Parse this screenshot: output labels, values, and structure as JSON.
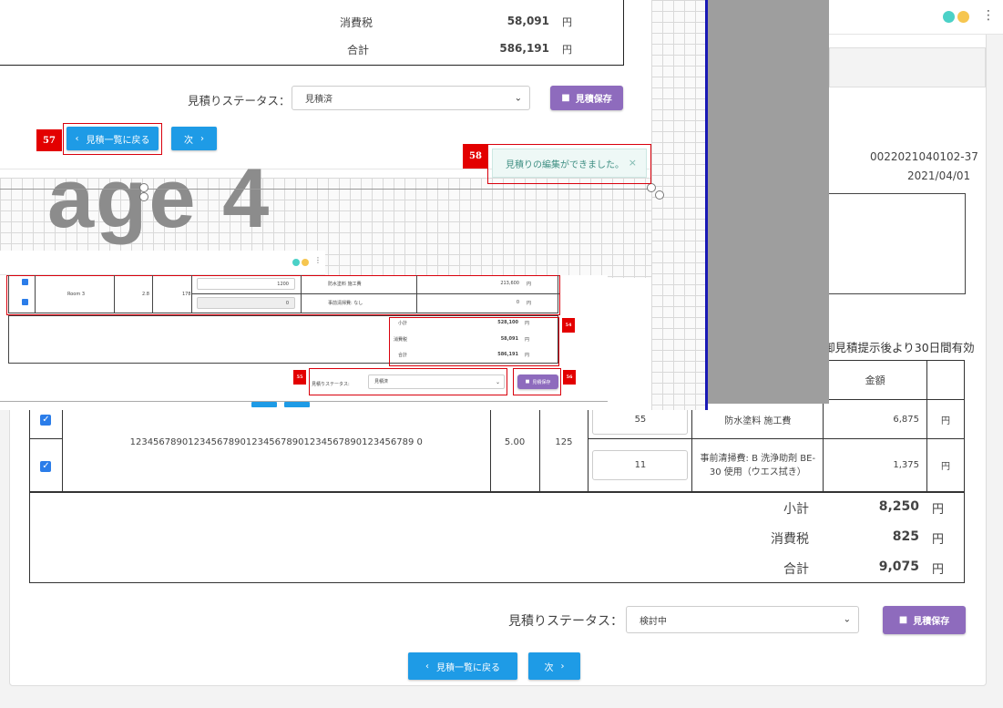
{
  "colors": {
    "accent_blue": "#1e9be6",
    "purple": "#8e6bbd",
    "annotation_red": "#e30000",
    "frame_blue": "#1a1ab5",
    "dot_teal": "#4bd1c7",
    "dot_yellow": "#f6c650"
  },
  "icons": {
    "save": "save-icon",
    "back": "chevron-left-icon",
    "next": "chevron-right-icon",
    "kebab": "kebab-menu-icon",
    "close": "close-icon"
  },
  "main": {
    "doc_number": "0022021040102-37",
    "doc_date": "2021/04/01",
    "validity_fragment": "御見積提示後より30日間有効",
    "table": {
      "amount_header": "金額",
      "rows": [
        {
          "qty": "55",
          "desc": "防水塗料 施工費",
          "amount": "6,875",
          "unit": "円"
        },
        {
          "qty": "11",
          "desc": "事前清掃費: B 洗浄助剤 BE-30 使用（ウエス拭き）",
          "amount": "1,375",
          "unit": "円"
        }
      ],
      "room_text": "1234567890123456789012345678901234567890123456789 0",
      "area": "5.00",
      "height": "125"
    },
    "totals": [
      {
        "label": "小計",
        "value": "8,250",
        "unit": "円"
      },
      {
        "label": "消費税",
        "value": "825",
        "unit": "円"
      },
      {
        "label": "合計",
        "value": "9,075",
        "unit": "円"
      }
    ],
    "status_label": "見積りステータス：",
    "status_value": "検討中",
    "save_label": "見積保存",
    "back_label": "見積一覧に戻る",
    "next_label": "次"
  },
  "overlay": {
    "totals": [
      {
        "label": "消費税",
        "value": "58,091",
        "unit": "円"
      },
      {
        "label": "合計",
        "value": "586,191",
        "unit": "円"
      }
    ],
    "status_label": "見積りステータス：",
    "status_value": "見積済",
    "save_label": "見積保存",
    "back_label": "見積一覧に戻る",
    "next_label": "次",
    "tag_57": "57",
    "tag_58": "58",
    "toast": "見積りの編集ができました。",
    "big_text": "age 4",
    "mini": {
      "room": "Room 3",
      "area": "2.8",
      "height": "178",
      "row1": {
        "qty": "1200",
        "desc": "防水塗料 施工費",
        "amount": "213,600",
        "unit": "円"
      },
      "row2": {
        "qty": "0",
        "desc": "事前清掃費: なし",
        "amount": "0",
        "unit": "円"
      },
      "totals": [
        {
          "label": "小計",
          "value": "528,100",
          "unit": "円"
        },
        {
          "label": "消費税",
          "value": "58,091",
          "unit": "円"
        },
        {
          "label": "合計",
          "value": "586,191",
          "unit": "円"
        }
      ],
      "status_label": "見積りステータス:",
      "status_value": "見積済",
      "save_label": "見積保存",
      "tag_54": "54",
      "tag_55": "55",
      "tag_56": "56"
    }
  }
}
